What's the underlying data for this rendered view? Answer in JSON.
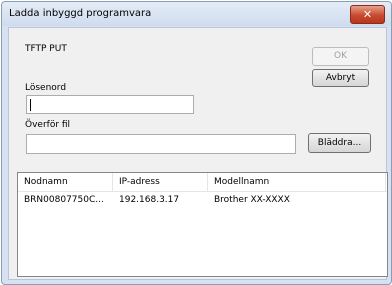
{
  "window": {
    "title": "Ladda inbyggd programvara",
    "close_glyph": "✕"
  },
  "form": {
    "mode_label": "TFTP PUT",
    "password_label": "Lösenord",
    "password_value": "",
    "file_label": "Överför fil",
    "file_value": ""
  },
  "buttons": {
    "ok": "OK",
    "cancel": "Avbryt",
    "browse": "Bläddra..."
  },
  "devices": {
    "columns": [
      "Nodnamn",
      "IP-adress",
      "Modellnamn"
    ],
    "rows": [
      {
        "node": "BRN00807750C...",
        "ip": "192.168.3.17",
        "model": "Brother XX-XXXX"
      }
    ]
  }
}
